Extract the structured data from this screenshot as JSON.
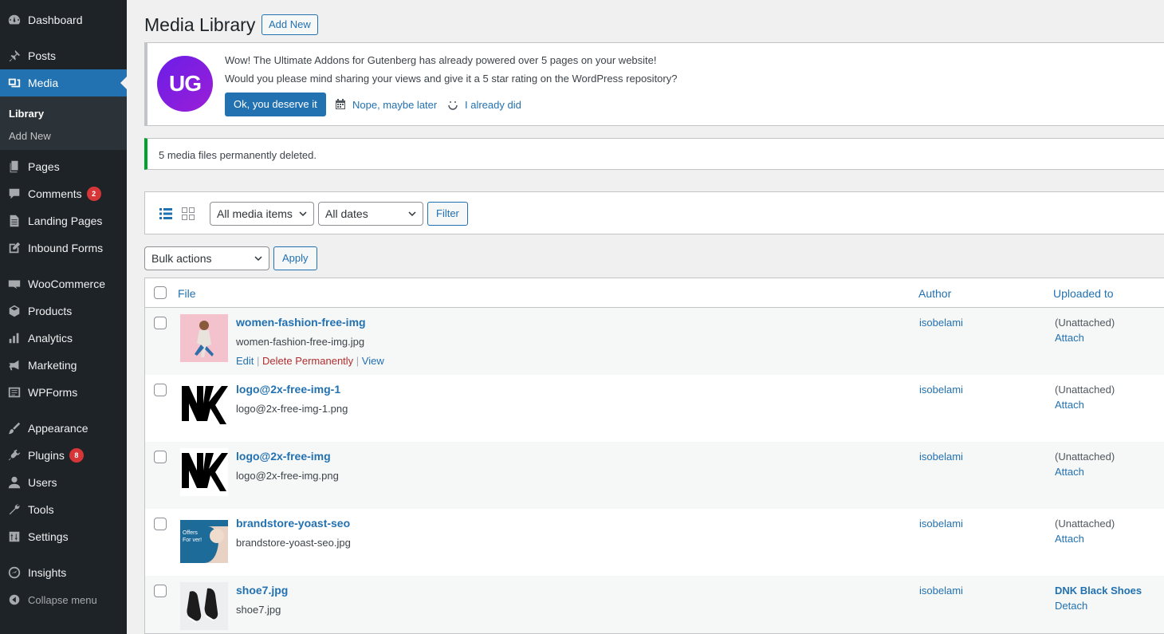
{
  "sidebar": {
    "items": [
      {
        "key": "dashboard",
        "label": "Dashboard",
        "icon": "dashboard-icon"
      },
      {
        "key": "posts",
        "label": "Posts",
        "icon": "pin-icon"
      },
      {
        "key": "media",
        "label": "Media",
        "icon": "media-icon"
      },
      {
        "key": "pages",
        "label": "Pages",
        "icon": "pages-icon"
      },
      {
        "key": "comments",
        "label": "Comments",
        "icon": "comment-icon",
        "badge": "2"
      },
      {
        "key": "landing",
        "label": "Landing Pages",
        "icon": "document-icon"
      },
      {
        "key": "inbound",
        "label": "Inbound Forms",
        "icon": "edit-icon"
      },
      {
        "key": "woocommerce",
        "label": "WooCommerce",
        "icon": "woo-icon"
      },
      {
        "key": "products",
        "label": "Products",
        "icon": "box-icon"
      },
      {
        "key": "analytics",
        "label": "Analytics",
        "icon": "bar-chart-icon"
      },
      {
        "key": "marketing",
        "label": "Marketing",
        "icon": "megaphone-icon"
      },
      {
        "key": "wpforms",
        "label": "WPForms",
        "icon": "form-icon"
      },
      {
        "key": "appearance",
        "label": "Appearance",
        "icon": "brush-icon"
      },
      {
        "key": "plugins",
        "label": "Plugins",
        "icon": "plugin-icon",
        "badge": "8"
      },
      {
        "key": "users",
        "label": "Users",
        "icon": "user-icon"
      },
      {
        "key": "tools",
        "label": "Tools",
        "icon": "wrench-icon"
      },
      {
        "key": "settings",
        "label": "Settings",
        "icon": "settings-icon"
      },
      {
        "key": "insights",
        "label": "Insights",
        "icon": "insights-icon"
      }
    ],
    "submenu": [
      "Library",
      "Add New"
    ],
    "collapse_label": "Collapse menu"
  },
  "header": {
    "title": "Media Library",
    "add_new": "Add New"
  },
  "uag_notice": {
    "logo": "UG",
    "line1": "Wow! The Ultimate Addons for Gutenberg has already powered over 5 pages on your website!",
    "line2": "Would you please mind sharing your views and give it a 5 star rating on the WordPress repository?",
    "ok": "Ok, you deserve it",
    "later": "Nope, maybe later",
    "did": "I already did"
  },
  "success_notice": "5 media files permanently deleted.",
  "filters": {
    "type": "All media items",
    "dates": "All dates",
    "filter_btn": "Filter",
    "bulk": "Bulk actions",
    "apply": "Apply"
  },
  "table": {
    "headers": {
      "file": "File",
      "author": "Author",
      "uploaded": "Uploaded to"
    },
    "row_actions": {
      "edit": "Edit",
      "delete": "Delete Permanently",
      "view": "View"
    },
    "rows": [
      {
        "title": "women-fashion-free-img",
        "file": "women-fashion-free-img.jpg",
        "author": "isobelami",
        "up1": "(Unattached)",
        "up2": "Attach"
      },
      {
        "title": "logo@2x-free-img-1",
        "file": "logo@2x-free-img-1.png",
        "author": "isobelami",
        "up1": "(Unattached)",
        "up2": "Attach"
      },
      {
        "title": "logo@2x-free-img",
        "file": "logo@2x-free-img.png",
        "author": "isobelami",
        "up1": "(Unattached)",
        "up2": "Attach"
      },
      {
        "title": "brandstore-yoast-seo",
        "file": "brandstore-yoast-seo.jpg",
        "author": "isobelami",
        "up1": "(Unattached)",
        "up2": "Attach",
        "thumb_text": "Offers For ver!"
      },
      {
        "title": "shoe7.jpg",
        "file": "shoe7.jpg",
        "author": "isobelami",
        "up1": "DNK Black Shoes",
        "up2": "Detach"
      }
    ]
  },
  "colors": {
    "sidebar_bg": "#1d2327",
    "accent": "#2271b1",
    "success": "#00a32a",
    "badge": "#d63638"
  }
}
